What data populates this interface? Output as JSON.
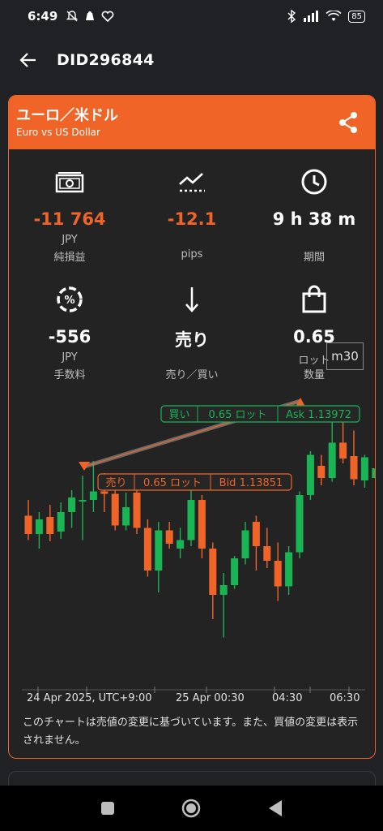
{
  "status_bar": {
    "time": "6:49",
    "battery": "85"
  },
  "header": {
    "title": "DID296844",
    "back_icon": "arrow-left-icon"
  },
  "instrument": {
    "name_jp": "ユーロ／米ドル",
    "name_en": "Euro vs US Dollar",
    "share_icon": "share-icon"
  },
  "stats": {
    "net_pl": {
      "value": "-11 764",
      "unit": "JPY",
      "label": "純損益",
      "icon": "money-icon"
    },
    "pips": {
      "value": "-12.1",
      "unit": "",
      "label": "pips",
      "icon": "trend-icon"
    },
    "duration": {
      "value": "9 h 38 m",
      "unit": "",
      "label": "期間",
      "icon": "clock-icon"
    },
    "fee": {
      "value": "-556",
      "unit": "JPY",
      "label": "手数料",
      "icon": "percent-icon"
    },
    "side": {
      "value": "売り",
      "unit": "",
      "label": "売り／買い",
      "icon": "arrow-down-icon"
    },
    "lots": {
      "value": "0.65",
      "unit": "ロット",
      "label": "数量",
      "icon": "bag-icon"
    }
  },
  "chart_data": {
    "type": "candlestick",
    "timeframe": "m30",
    "x_labels": [
      "24 Apr 2025, UTC+9:00",
      "25 Apr 00:30",
      "04:30",
      "06:30"
    ],
    "buy_marker": {
      "side": "買い",
      "lots": "0.65 ロット",
      "price_label": "Ask 1.13972"
    },
    "sell_marker": {
      "side": "売り",
      "lots": "0.65 ロット",
      "price_label": "Bid 1.13851"
    },
    "colors": {
      "up": "#19b453",
      "down": "#f06428"
    },
    "candles": [
      {
        "o": 55,
        "c": 40,
        "h": 68,
        "l": 35
      },
      {
        "o": 40,
        "c": 52,
        "h": 58,
        "l": 28
      },
      {
        "o": 54,
        "c": 40,
        "h": 64,
        "l": 34
      },
      {
        "o": 42,
        "c": 58,
        "h": 66,
        "l": 36
      },
      {
        "o": 58,
        "c": 70,
        "h": 76,
        "l": 45
      },
      {
        "o": 68,
        "c": 68,
        "h": 88,
        "l": 35
      },
      {
        "o": 68,
        "c": 75,
        "h": 100,
        "l": 58
      },
      {
        "o": 75,
        "c": 73,
        "h": 90,
        "l": 58
      },
      {
        "o": 73,
        "c": 47,
        "h": 82,
        "l": 43
      },
      {
        "o": 47,
        "c": 62,
        "h": 74,
        "l": 43
      },
      {
        "o": 74,
        "c": 45,
        "h": 80,
        "l": 40
      },
      {
        "o": 45,
        "c": 10,
        "h": 52,
        "l": 5
      },
      {
        "o": 10,
        "c": 43,
        "h": 50,
        "l": -8
      },
      {
        "o": 43,
        "c": 32,
        "h": 50,
        "l": 28
      },
      {
        "o": 28,
        "c": 35,
        "h": 45,
        "l": 20
      },
      {
        "o": 35,
        "c": 68,
        "h": 85,
        "l": 30
      },
      {
        "o": 68,
        "c": 28,
        "h": 72,
        "l": 20
      },
      {
        "o": 28,
        "c": -10,
        "h": 33,
        "l": -30
      },
      {
        "o": -10,
        "c": -2,
        "h": 8,
        "l": -45
      },
      {
        "o": -2,
        "c": 20,
        "h": 22,
        "l": -5
      },
      {
        "o": 20,
        "c": 43,
        "h": 50,
        "l": 15
      },
      {
        "o": 50,
        "c": 30,
        "h": 55,
        "l": 10
      },
      {
        "o": 30,
        "c": 18,
        "h": 45,
        "l": 12
      },
      {
        "o": 18,
        "c": -3,
        "h": 33,
        "l": -15
      },
      {
        "o": -3,
        "c": 25,
        "h": 30,
        "l": -10
      },
      {
        "o": 25,
        "c": 72,
        "h": 75,
        "l": 20
      },
      {
        "o": 72,
        "c": 105,
        "h": 108,
        "l": 68
      },
      {
        "o": 96,
        "c": 86,
        "h": 105,
        "l": 80
      },
      {
        "o": 86,
        "c": 115,
        "h": 135,
        "l": 83
      },
      {
        "o": 115,
        "c": 102,
        "h": 140,
        "l": 98
      },
      {
        "o": 104,
        "c": 85,
        "h": 125,
        "l": 80
      },
      {
        "o": 84,
        "c": 103,
        "h": 105,
        "l": 78
      },
      {
        "o": 86,
        "c": 94,
        "h": 98,
        "l": 80
      }
    ]
  },
  "chart_note": "このチャートは売値の変更に基づいています。また、買値の変更は表示されません。"
}
